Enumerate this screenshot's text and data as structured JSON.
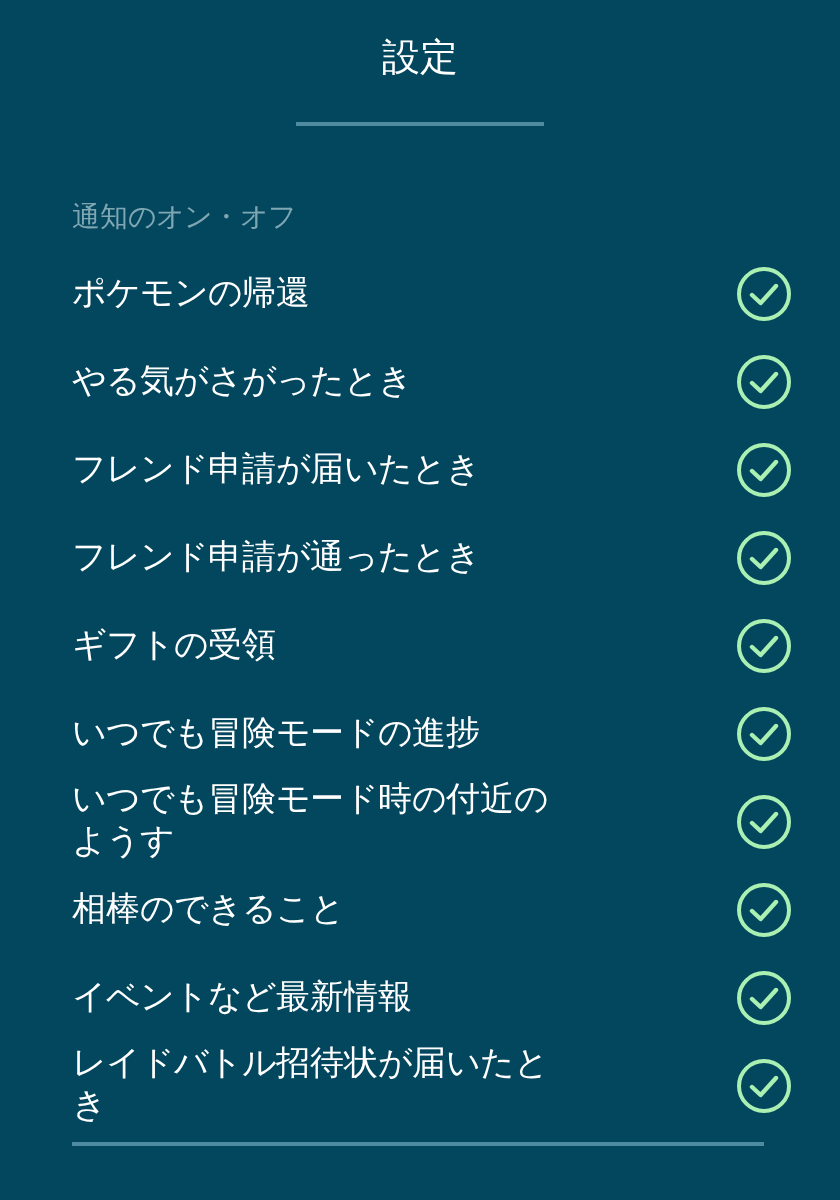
{
  "title": "設定",
  "section": {
    "label": "通知のオン・オフ",
    "items": [
      {
        "label": "ポケモンの帰還",
        "checked": true
      },
      {
        "label": "やる気がさがったとき",
        "checked": true
      },
      {
        "label": "フレンド申請が届いたとき",
        "checked": true
      },
      {
        "label": "フレンド申請が通ったとき",
        "checked": true
      },
      {
        "label": "ギフトの受領",
        "checked": true
      },
      {
        "label": "いつでも冒険モードの進捗",
        "checked": true
      },
      {
        "label": "いつでも冒険モード時の付近のようす",
        "checked": true
      },
      {
        "label": "相棒のできること",
        "checked": true
      },
      {
        "label": "イベントなど最新情報",
        "checked": true
      },
      {
        "label": "レイドバトル招待状が届いたとき",
        "checked": true
      }
    ]
  }
}
